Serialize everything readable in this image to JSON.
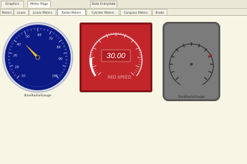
{
  "top_tabs": [
    {
      "label": "Graphics"
    },
    {
      "label": "Meter Page"
    },
    {
      "label": "Data Entrydata"
    }
  ],
  "sub_tabs": [
    {
      "label": "Meters"
    },
    {
      "label": "Linear"
    },
    {
      "label": "Linear Meters"
    },
    {
      "label": "Radial Meters"
    },
    {
      "label": "Cylinder Meters"
    },
    {
      "label": "Compass Meters"
    },
    {
      "label": "Knobs"
    }
  ],
  "gauges": {
    "blue": {
      "caption": "BlueRadialGauge",
      "value": 34,
      "scale_min": 0,
      "scale_max": 100,
      "tick_labels": [
        "10",
        "20",
        "30",
        "40",
        "50",
        "60",
        "70",
        "80",
        "90",
        "100"
      ],
      "face_color": "#0c1a86",
      "needle_color": "#f0c020"
    },
    "red": {
      "readout": "30.00",
      "scale_label": "RED SPEED",
      "face_color": "#c2262b"
    },
    "gray": {
      "caption": "DarkRadialGauge",
      "face_color": "#7b7b7b",
      "accent_color": "#b2252d"
    }
  }
}
